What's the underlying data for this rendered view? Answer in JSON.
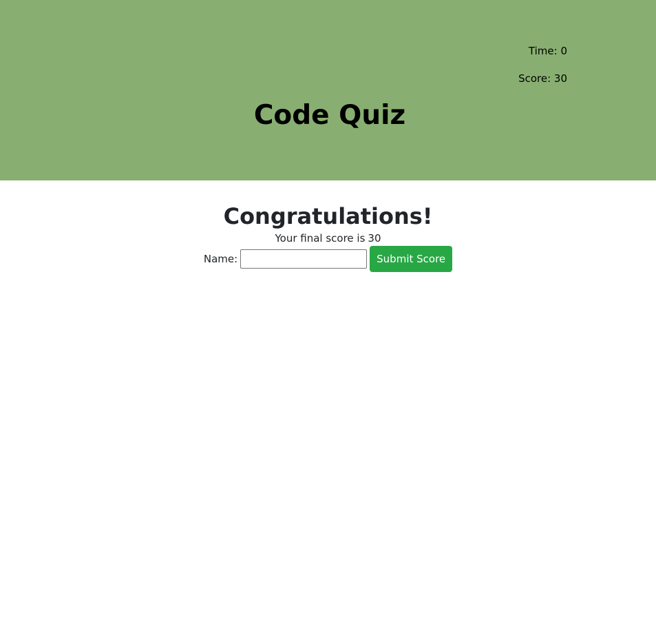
{
  "header": {
    "time_label": "Time: 0",
    "score_label": "Score: 30",
    "title": "Code Quiz"
  },
  "result": {
    "heading": "Congratulations!",
    "final_score_text": "Your final score is",
    "final_score_value": "30"
  },
  "form": {
    "name_label": "Name:",
    "name_value": "",
    "submit_label": "Submit Score"
  },
  "colors": {
    "header_bg": "#88af71",
    "submit_bg": "#28a745"
  }
}
